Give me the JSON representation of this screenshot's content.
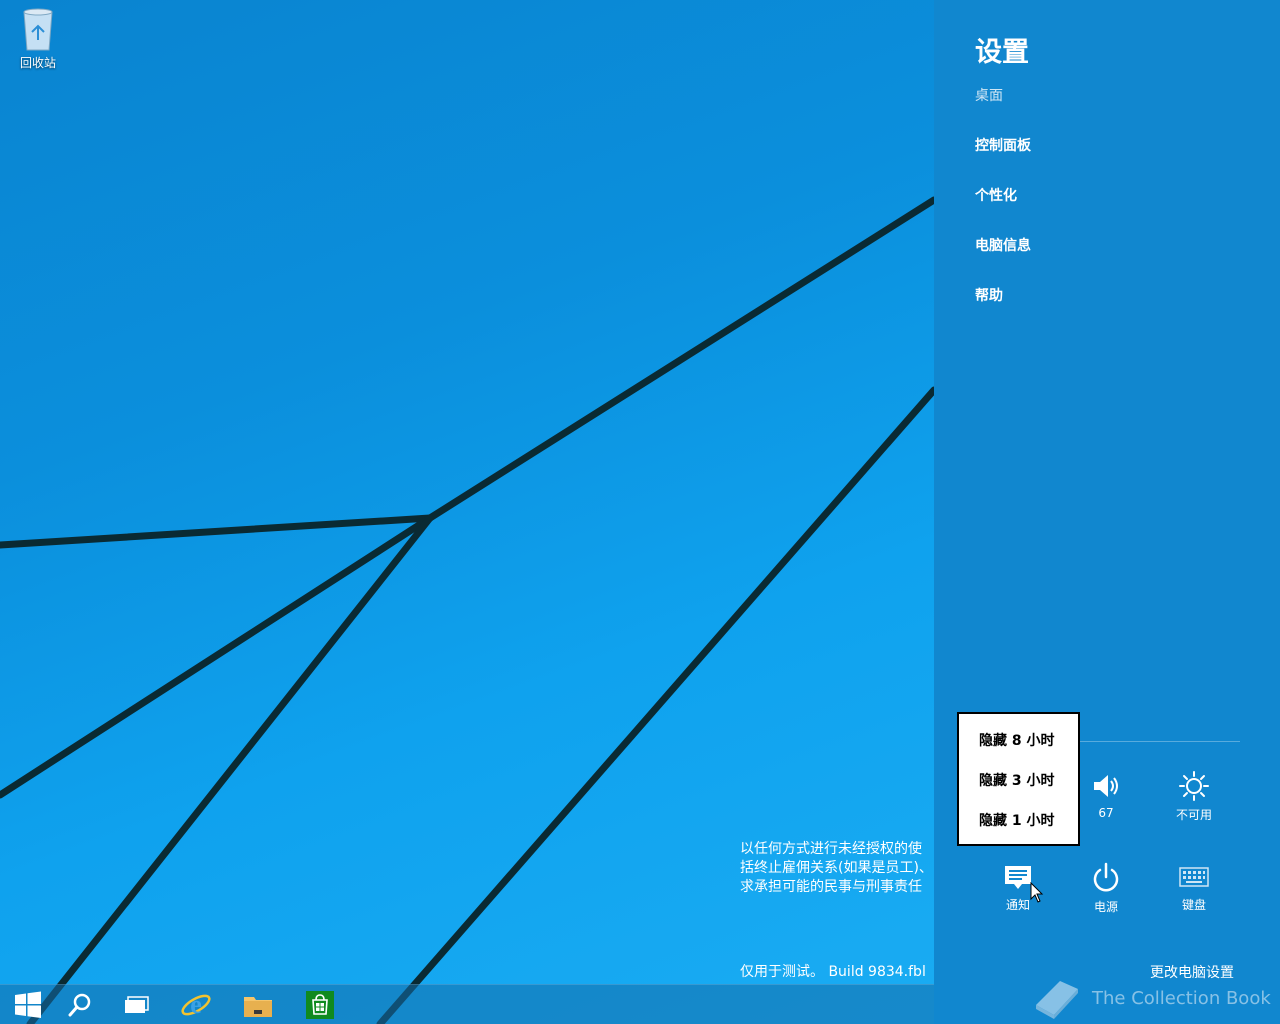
{
  "desktop": {
    "recycle_bin_label": "回收站",
    "watermark_legal": [
      "以任何方式进行未经授权的使",
      "括终止雇佣关系(如果是员工)、",
      "求承担可能的民事与刑事责任"
    ],
    "watermark_build": "仅用于测试。 Build 9834.fbl"
  },
  "taskbar": {
    "items": [
      {
        "icon": "windows-start-icon"
      },
      {
        "icon": "search-icon"
      },
      {
        "icon": "task-view-icon"
      },
      {
        "icon": "internet-explorer-icon"
      },
      {
        "icon": "file-explorer-icon"
      },
      {
        "icon": "store-icon"
      }
    ]
  },
  "settings": {
    "title": "设置",
    "subtitle": "桌面",
    "links": [
      "控制面板",
      "个性化",
      "电脑信息",
      "帮助"
    ],
    "quick": {
      "volume_value": "67",
      "brightness_label": "不可用",
      "notifications_label": "通知",
      "power_label": "电源",
      "keyboard_label": "键盘"
    },
    "change_pc_settings": "更改电脑设置"
  },
  "snooze_menu": {
    "items": [
      "隐藏 8 小时",
      "隐藏 3 小时",
      "隐藏 1 小时"
    ]
  },
  "branding": {
    "logo_text": "The Collection Book"
  },
  "colors": {
    "pane_bg": "#1187cf",
    "desktop_bg": "#0f97e4"
  }
}
